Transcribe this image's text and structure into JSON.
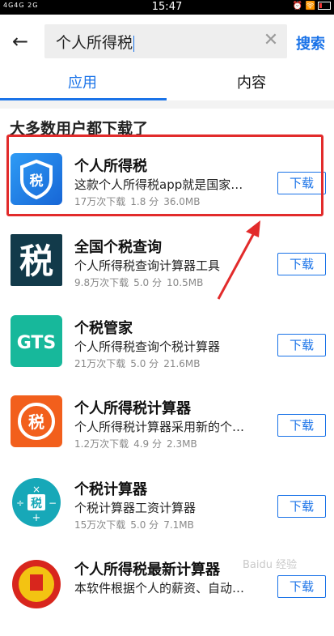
{
  "status_bar": {
    "left": "4G4G 2G",
    "time": "15:47",
    "right": "⏰ 🛜"
  },
  "search": {
    "back_icon": "back-arrow-icon",
    "query": "个人所得税",
    "clear_icon": "clear-icon",
    "button_label": "搜索"
  },
  "tabs": [
    {
      "label": "应用",
      "active": true
    },
    {
      "label": "内容",
      "active": false
    }
  ],
  "section_title": "大多数用户都下载了",
  "apps": [
    {
      "name": "个人所得税",
      "desc": "这款个人所得税app就是国家…",
      "downloads": "17万次下载",
      "rating": "1.8 分",
      "size": "36.0MB",
      "button": "下载"
    },
    {
      "name": "全国个税查询",
      "desc": "个人所得税查询计算器工具",
      "downloads": "9.8万次下载",
      "rating": "5.0 分",
      "size": "10.5MB",
      "button": "下载"
    },
    {
      "name": "个税管家",
      "desc": "个人所得税查询个税计算器",
      "downloads": "21万次下载",
      "rating": "5.0 分",
      "size": "21.6MB",
      "button": "下载"
    },
    {
      "name": "个人所得税计算器",
      "desc": "个人所得税计算器采用新的个…",
      "downloads": "1.2万次下载",
      "rating": "4.9 分",
      "size": "2.3MB",
      "button": "下载"
    },
    {
      "name": "个税计算器",
      "desc": "个税计算器工资计算器",
      "downloads": "15万次下载",
      "rating": "5.0 分",
      "size": "7.1MB",
      "button": "下载"
    },
    {
      "name": "个人所得税最新计算器",
      "desc": "本软件根据个人的薪资、自动…",
      "downloads": "",
      "rating": "",
      "size": "",
      "button": "下载"
    }
  ],
  "icon_glyphs": {
    "tax": "税",
    "gts": "GTS"
  },
  "watermark": "Baidu 经验",
  "colors": {
    "accent": "#1a73e8",
    "highlight": "#e22b2b"
  }
}
